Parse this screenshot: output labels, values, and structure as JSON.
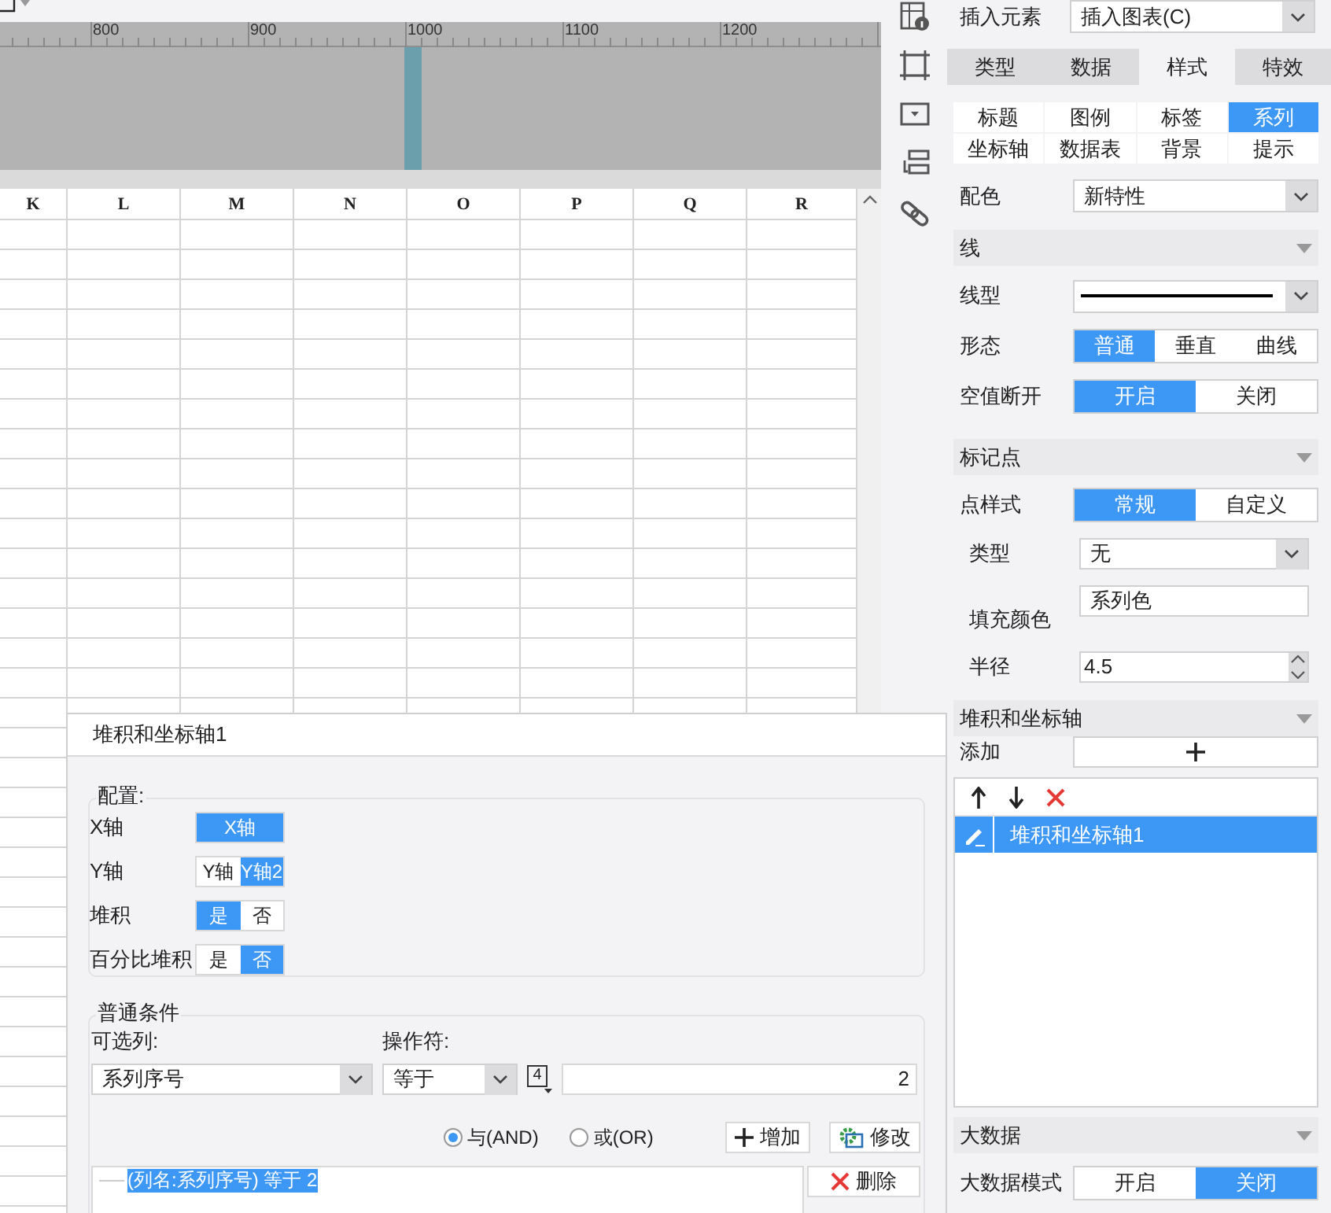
{
  "ruler": {
    "labels": [
      "800",
      "900",
      "1000",
      "1100",
      "1200"
    ]
  },
  "sheet": {
    "columns": [
      "K",
      "L",
      "M",
      "N",
      "O",
      "P",
      "Q",
      "R"
    ]
  },
  "panel": {
    "insert": {
      "label": "插入元素",
      "value": "插入图表(C)"
    },
    "tabs": [
      {
        "label": "类型",
        "selected": false
      },
      {
        "label": "数据",
        "selected": false
      },
      {
        "label": "样式",
        "selected": true
      },
      {
        "label": "特效",
        "selected": false
      }
    ],
    "subtabs": [
      {
        "label": "标题",
        "selected": false
      },
      {
        "label": "图例",
        "selected": false
      },
      {
        "label": "标签",
        "selected": false
      },
      {
        "label": "系列",
        "selected": true
      },
      {
        "label": "坐标轴",
        "selected": false
      },
      {
        "label": "数据表",
        "selected": false
      },
      {
        "label": "背景",
        "selected": false
      },
      {
        "label": "提示",
        "selected": false
      }
    ],
    "rows": [
      {
        "kind": "select",
        "label": "配色",
        "value": "新特性"
      },
      {
        "kind": "section",
        "label": "线"
      },
      {
        "kind": "line_select",
        "label": "线型"
      },
      {
        "kind": "segmented",
        "label": "形态",
        "options": [
          {
            "label": "普通",
            "selected": true
          },
          {
            "label": "垂直",
            "selected": false
          },
          {
            "label": "曲线",
            "selected": false
          }
        ]
      },
      {
        "kind": "segmented",
        "label": "空值断开",
        "options": [
          {
            "label": "开启",
            "selected": true
          },
          {
            "label": "关闭",
            "selected": false
          }
        ]
      },
      {
        "kind": "section",
        "label": "标记点"
      },
      {
        "kind": "segmented",
        "label": "点样式",
        "options": [
          {
            "label": "常规",
            "selected": true
          },
          {
            "label": "自定义",
            "selected": false
          }
        ]
      },
      {
        "kind": "sub_select",
        "label": "类型",
        "value": "无"
      },
      {
        "kind": "sub_field",
        "label": "填充颜色",
        "value": "系列色"
      },
      {
        "kind": "sub_spinner",
        "label": "半径",
        "value": "4.5"
      },
      {
        "kind": "section",
        "label": "堆积和坐标轴"
      },
      {
        "kind": "add",
        "label": "添加"
      },
      {
        "kind": "list",
        "items": [
          {
            "label": "堆积和坐标轴1",
            "selected": true
          }
        ]
      },
      {
        "kind": "section",
        "label": "大数据"
      },
      {
        "kind": "segmented",
        "label": "大数据模式",
        "options": [
          {
            "label": "开启",
            "selected": false
          },
          {
            "label": "关闭",
            "selected": true
          }
        ]
      }
    ]
  },
  "dialog": {
    "title": "堆积和坐标轴1",
    "config": {
      "legend": "配置:",
      "rows": [
        {
          "label": "X轴",
          "options": [
            {
              "label": "X轴",
              "selected": true
            }
          ]
        },
        {
          "label": "Y轴",
          "options": [
            {
              "label": "Y轴",
              "selected": false
            },
            {
              "label": "Y轴2",
              "selected": true
            }
          ]
        },
        {
          "label": "堆积",
          "options": [
            {
              "label": "是",
              "selected": true
            },
            {
              "label": "否",
              "selected": false
            }
          ]
        },
        {
          "label": "百分比堆积",
          "options": [
            {
              "label": "是",
              "selected": false
            },
            {
              "label": "否",
              "selected": true
            }
          ]
        }
      ]
    },
    "conditions": {
      "legend": "普通条件",
      "column_label": "可选列:",
      "column_value": "系列序号",
      "operator_label": "操作符:",
      "operator_value": "等于",
      "formula_icon_label": "4",
      "value": "2",
      "logic": [
        {
          "label": "与(AND)",
          "selected": true
        },
        {
          "label": "或(OR)",
          "selected": false
        }
      ],
      "buttons": [
        {
          "kind": "add",
          "label": "增加"
        },
        {
          "kind": "edit",
          "label": "修改"
        }
      ],
      "items": [
        {
          "label": "(列名:系列序号) 等于 2",
          "selected": true
        }
      ],
      "delete_button": "删除"
    }
  }
}
